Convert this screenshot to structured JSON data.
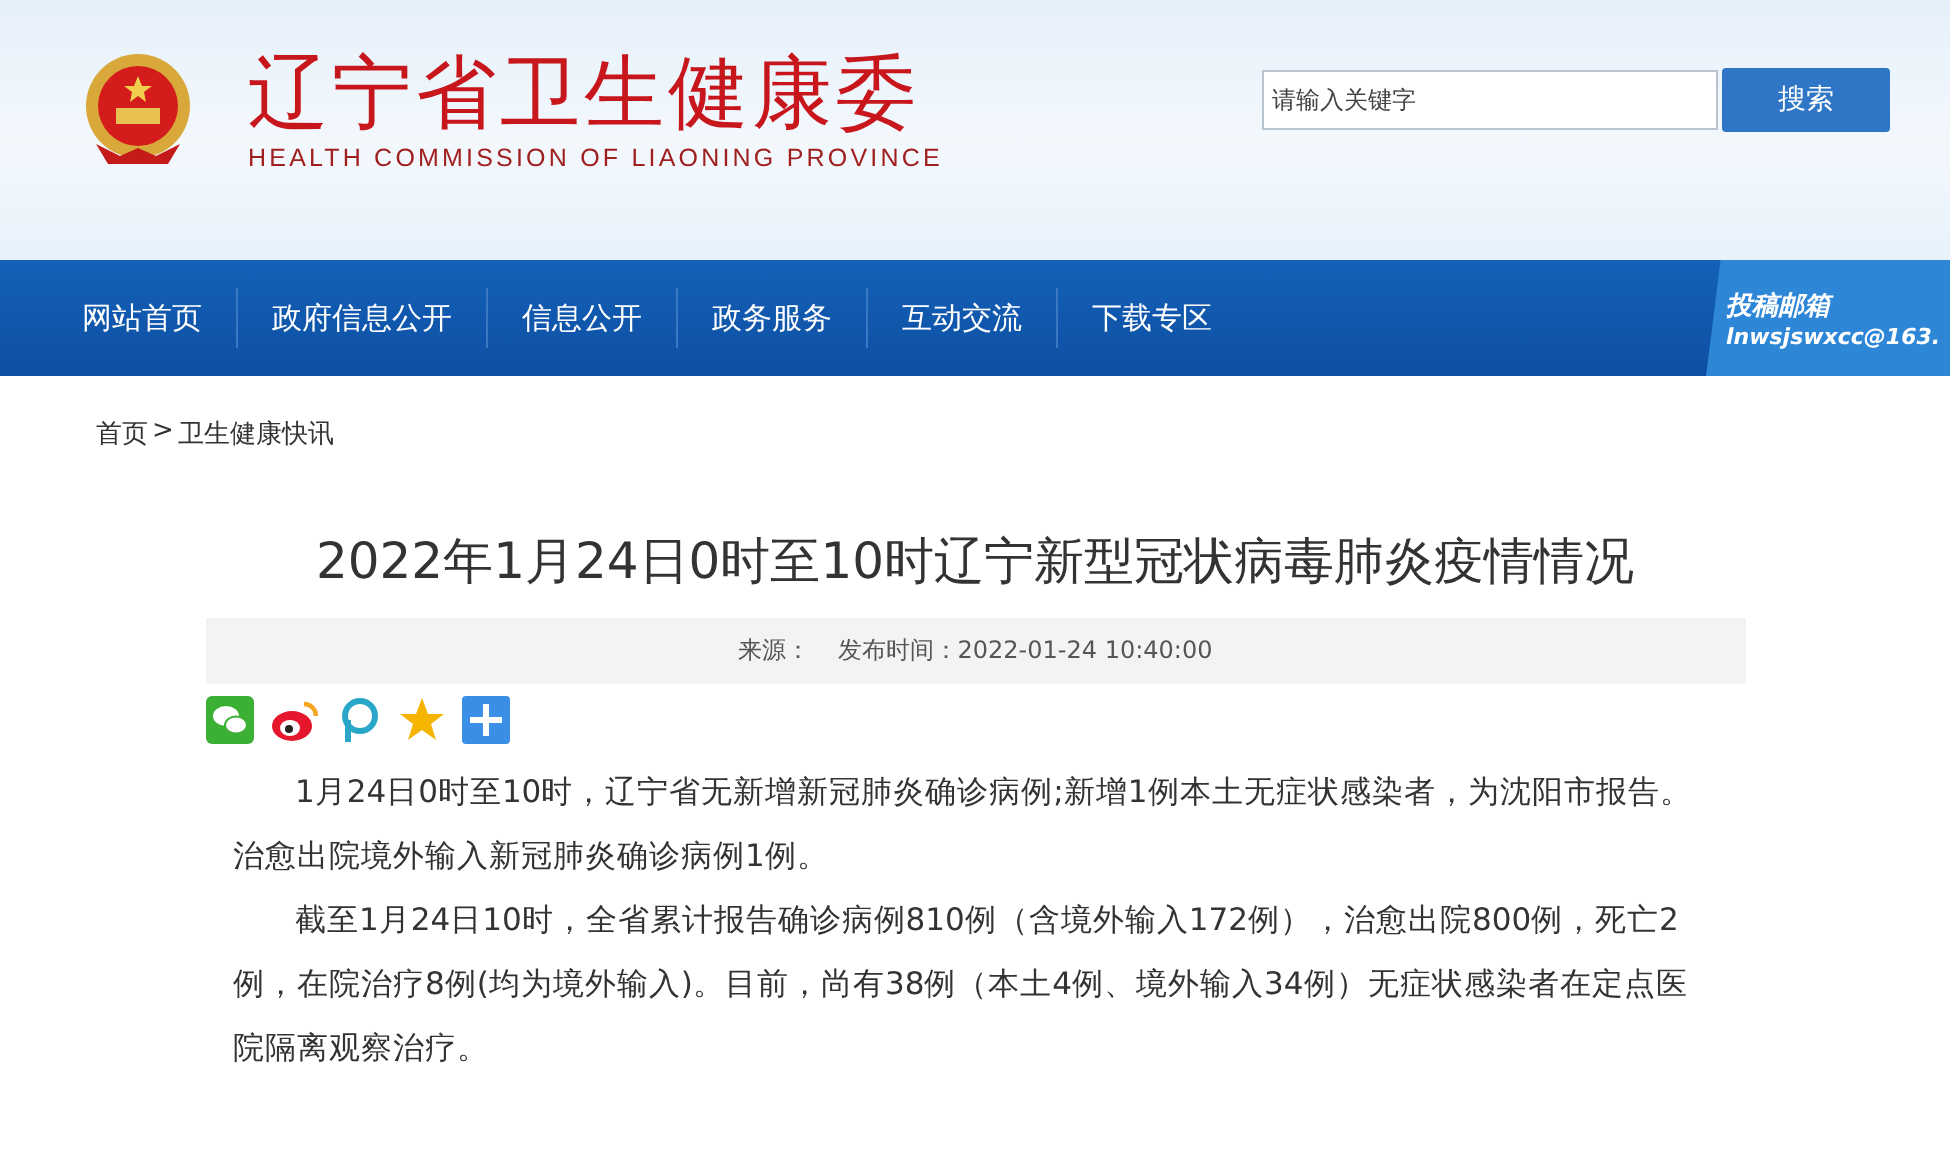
{
  "header": {
    "title": "辽宁省卫生健康委",
    "subtitle": "HEALTH COMMISSION OF LIAONING PROVINCE",
    "search": {
      "placeholder": "请输入关键字",
      "button": "搜索"
    }
  },
  "nav": {
    "items": [
      {
        "label": "网站首页",
        "selected": false
      },
      {
        "label": "政府信息公开",
        "selected": false
      },
      {
        "label": "信息公开",
        "selected": false
      },
      {
        "label": "政务服务",
        "selected": false
      },
      {
        "label": "互动交流",
        "selected": false
      },
      {
        "label": "下载专区",
        "selected": false
      }
    ],
    "mailbox": {
      "title": "投稿邮箱",
      "email": "lnwsjswxcc@163."
    }
  },
  "breadcrumb": {
    "items": [
      "首页",
      "卫生健康快讯"
    ],
    "separator": ">"
  },
  "article": {
    "title": "2022年1月24日0时至10时辽宁新型冠状病毒肺炎疫情情况",
    "source_label": "来源：",
    "published": "发布时间：2022-01-24 10:40:00",
    "paragraphs": [
      "1月24日0时至10时，辽宁省无新增新冠肺炎确诊病例;新增1例本土无症状感染者，为沈阳市报告。治愈出院境外输入新冠肺炎确诊病例1例。",
      "截至1月24日10时，全省累计报告确诊病例810例（含境外输入172例），治愈出院800例，死亡2例，在院治疗8例(均为境外输入)。目前，尚有38例（本土4例、境外输入34例）无症状感染者在定点医院隔离观察治疗。"
    ]
  }
}
